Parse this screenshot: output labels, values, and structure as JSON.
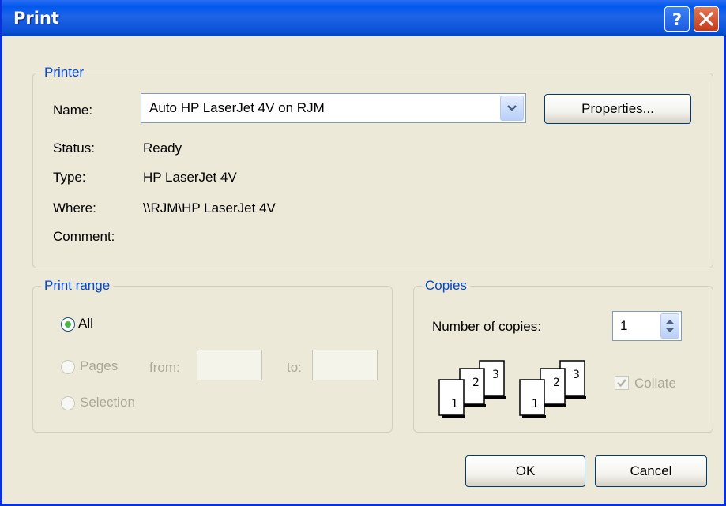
{
  "window": {
    "title": "Print"
  },
  "titlebar": {
    "help_icon": "question-mark-icon",
    "close_icon": "close-x-icon"
  },
  "printer": {
    "legend": "Printer",
    "name_label": "Name:",
    "name_value": "Auto HP LaserJet 4V on RJM",
    "properties_label": "Properties...",
    "status_label": "Status:",
    "status_value": "Ready",
    "type_label": "Type:",
    "type_value": "HP LaserJet 4V",
    "where_label": "Where:",
    "where_value": "\\\\RJM\\HP LaserJet 4V",
    "comment_label": "Comment:",
    "comment_value": ""
  },
  "print_range": {
    "legend": "Print range",
    "all_label": "All",
    "pages_label": "Pages",
    "from_label": "from:",
    "from_value": "",
    "to_label": "to:",
    "to_value": "",
    "selection_label": "Selection",
    "selected": "All"
  },
  "copies": {
    "legend": "Copies",
    "number_label": "Number of copies:",
    "number_value": "1",
    "collate_label": "Collate",
    "collate_checked": true,
    "collate_disabled": true,
    "page_numbers": [
      "1",
      "2",
      "3"
    ]
  },
  "footer": {
    "ok_label": "OK",
    "cancel_label": "Cancel"
  },
  "colors": {
    "title_bar": "#0058EE",
    "dialog_bg": "#ECE9D8",
    "legend_text": "#0046D5",
    "close_button": "#C53A18"
  }
}
